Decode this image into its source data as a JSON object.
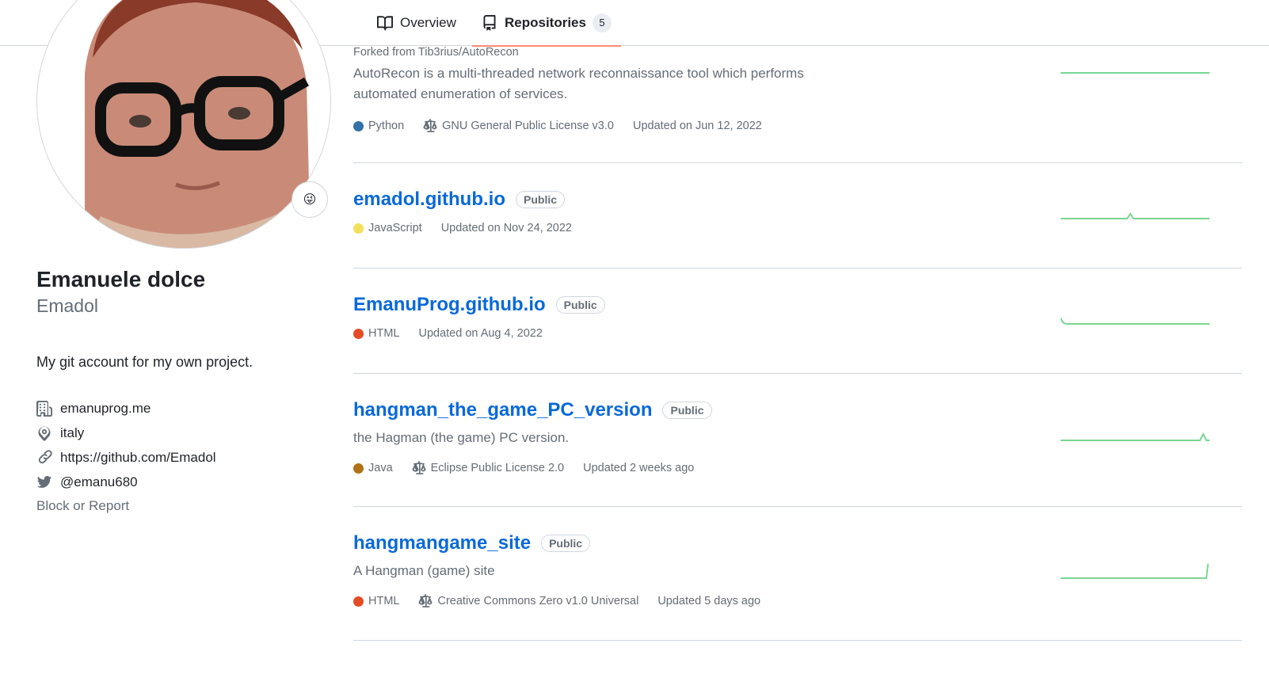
{
  "nav": {
    "tabs": [
      {
        "label": "Overview",
        "icon": "book-icon"
      },
      {
        "label": "Repositories",
        "icon": "repo-icon",
        "count": "5"
      }
    ]
  },
  "profile": {
    "name": "Emanuele dolce",
    "login": "Emadol",
    "bio": "My git account for my own project.",
    "details": [
      {
        "icon": "organization-icon",
        "text": "emanuprog.me"
      },
      {
        "icon": "location-icon",
        "text": "italy"
      },
      {
        "icon": "link-icon",
        "text": "https://github.com/Emadol"
      },
      {
        "icon": "twitter-icon",
        "text": "@emanu680"
      }
    ],
    "block_report": "Block or Report",
    "status_emoji": "😜"
  },
  "repos": [
    {
      "forked_from": "Forked from Tib3rius/AutoRecon",
      "description": "AutoRecon is a multi-threaded network reconnaissance tool which performs automated enumeration of services.",
      "language": "Python",
      "language_color": "#3572A5",
      "license": "GNU General Public License v3.0",
      "updated": "Updated on Jun 12, 2022"
    },
    {
      "name": "emadol.github.io",
      "visibility": "Public",
      "language": "JavaScript",
      "language_color": "#f1e05a",
      "updated": "Updated on Nov 24, 2022"
    },
    {
      "name": "EmanuProg.github.io",
      "visibility": "Public",
      "language": "HTML",
      "language_color": "#e34c26",
      "updated": "Updated on Aug 4, 2022"
    },
    {
      "name": "hangman_the_game_PC_version",
      "visibility": "Public",
      "description": "the Hagman (the game) PC version.",
      "language": "Java",
      "language_color": "#b07219",
      "license": "Eclipse Public License 2.0",
      "updated": "Updated 2 weeks ago"
    },
    {
      "name": "hangmangame_site",
      "visibility": "Public",
      "description": "A Hangman (game) site",
      "language": "HTML",
      "language_color": "#e34c26",
      "license": "Creative Commons Zero v1.0 Universal",
      "updated": "Updated 5 days ago"
    }
  ],
  "colors": {
    "accent": "#0969da",
    "tab_underline": "#fd8c73",
    "sparkline": "#40c463"
  }
}
